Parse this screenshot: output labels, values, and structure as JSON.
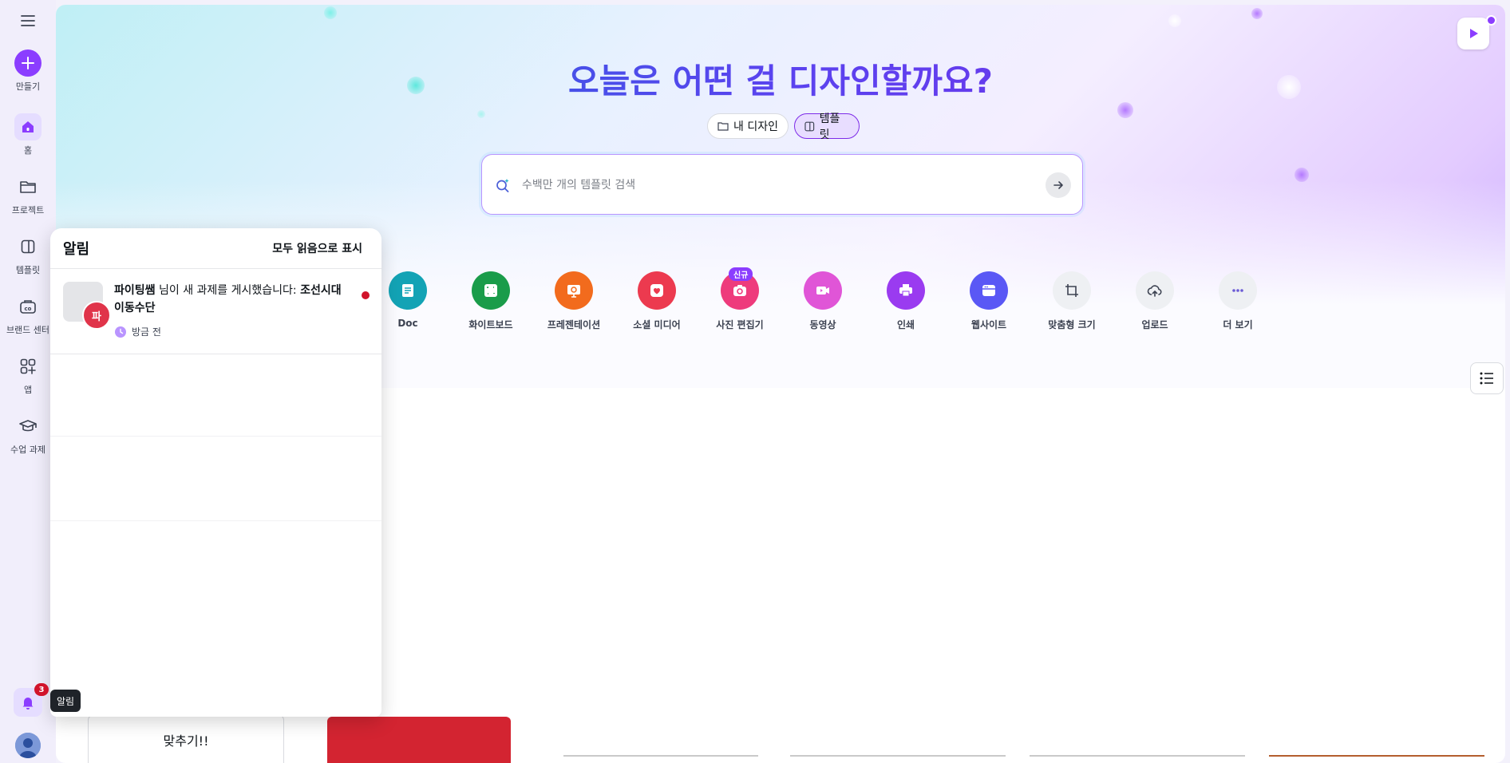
{
  "sidebar": {
    "create": "만들기",
    "home": "홈",
    "projects": "프로젝트",
    "templates": "템플릿",
    "brand": "브랜드 센터",
    "apps": "앱",
    "classwork": "수업 과제"
  },
  "hero": {
    "title": "오늘은 어떤 걸 디자인할까요?",
    "my_designs": "내 디자인",
    "templates": "템플릿",
    "search_placeholder": "수백만 개의 템플릿 검색"
  },
  "categories": [
    {
      "label": "Doc",
      "icon": "doc-icon",
      "color": "#13a3b5"
    },
    {
      "label": "화이트보드",
      "icon": "whiteboard-icon",
      "color": "#1a9c4a"
    },
    {
      "label": "프레젠테이션",
      "icon": "presentation-icon",
      "color": "#f26b1d"
    },
    {
      "label": "소셜 미디어",
      "icon": "heart-icon",
      "color": "#ec3a4f"
    },
    {
      "label": "사진 편집기",
      "icon": "camera-icon",
      "color": "#ee3b7c",
      "badge": "신규"
    },
    {
      "label": "동영상",
      "icon": "video-icon",
      "color": "#e055d7"
    },
    {
      "label": "인쇄",
      "icon": "printer-icon",
      "color": "#9a3bf0"
    },
    {
      "label": "웹사이트",
      "icon": "website-icon",
      "color": "#5a58f5"
    },
    {
      "label": "맞춤형 크기",
      "icon": "crop-icon",
      "color": "#eef0f3"
    },
    {
      "label": "업로드",
      "icon": "cloud-upload-icon",
      "color": "#eef0f3"
    },
    {
      "label": "더 보기",
      "icon": "more-icon",
      "color": "#eef0f3"
    }
  ],
  "notifications": {
    "title": "알림",
    "mark_all_read": "모두 읽음으로 표시",
    "items": [
      {
        "author": "파이팅쌤",
        "message": " 님이 새 과제를 게시했습니다: ",
        "assignment": "조선시대 이동수단",
        "time": "방금 전",
        "avatar_letter": "파"
      }
    ]
  },
  "bell": {
    "badge": "3",
    "tooltip": "알림"
  },
  "cards": {
    "first_card_text": "맞추기!!"
  }
}
